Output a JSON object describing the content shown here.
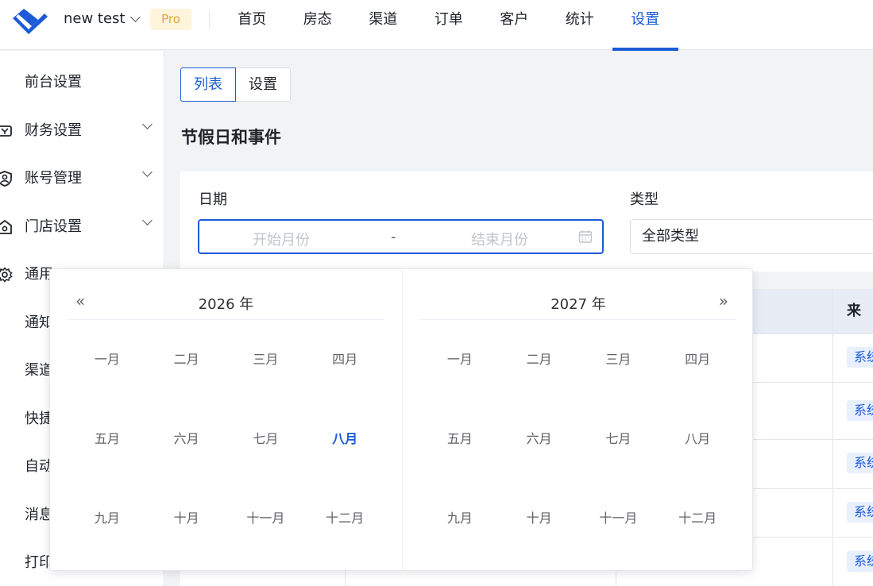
{
  "header": {
    "account_name": "new test",
    "pro_badge": "Pro",
    "nav": [
      {
        "label": "首页"
      },
      {
        "label": "房态"
      },
      {
        "label": "渠道"
      },
      {
        "label": "订单"
      },
      {
        "label": "客户"
      },
      {
        "label": "统计"
      },
      {
        "label": "设置",
        "active": true
      }
    ],
    "accent_color": "#1c5bd6"
  },
  "sidebar": {
    "items": [
      {
        "label": "前台设置",
        "icon": ""
      },
      {
        "label": "财务设置",
        "icon": "finance-icon",
        "expandable": true
      },
      {
        "label": "账号管理",
        "icon": "account-shield-icon",
        "expandable": true
      },
      {
        "label": "门店设置",
        "icon": "store-icon",
        "expandable": true
      },
      {
        "label": "通用",
        "icon": "gear-icon"
      },
      {
        "label": "通知"
      },
      {
        "label": "渠道"
      },
      {
        "label": "快捷"
      },
      {
        "label": "自动"
      },
      {
        "label": "消息"
      },
      {
        "label": "打印"
      }
    ]
  },
  "main": {
    "tabs": [
      {
        "label": "列表",
        "active": true
      },
      {
        "label": "设置"
      }
    ],
    "page_title": "节假日和事件",
    "filters": {
      "date_label": "日期",
      "start_placeholder": "开始月份",
      "separator": "-",
      "end_placeholder": "结束月份",
      "type_label": "类型",
      "type_value": "全部类型"
    },
    "table": {
      "visible_header": "来源",
      "source_badges": [
        "系统",
        "系统",
        "系统",
        "系统",
        "系统"
      ]
    }
  },
  "month_picker": {
    "left_year": "2026 年",
    "right_year": "2027 年",
    "prev_arrow": "«",
    "next_arrow": "»",
    "months": [
      "一月",
      "二月",
      "三月",
      "四月",
      "五月",
      "六月",
      "七月",
      "八月",
      "九月",
      "十月",
      "十一月",
      "十二月"
    ],
    "current_month_left": "八月"
  }
}
